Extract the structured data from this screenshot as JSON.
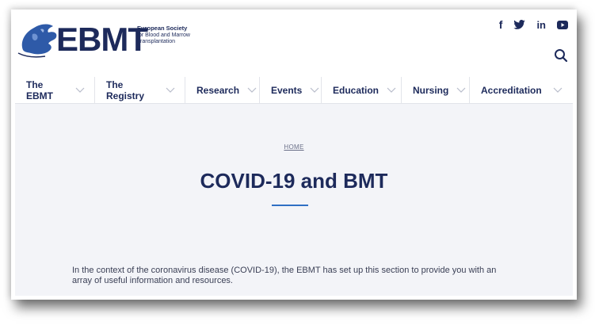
{
  "brand": {
    "logo_text": "EBMT",
    "tagline_line1": "European Society",
    "tagline_line2": "for Blood and Marrow",
    "tagline_line3": "Transplantation",
    "color_primary": "#1d2a5b",
    "color_accent": "#2f6fc4"
  },
  "social": {
    "icons": [
      "facebook-icon",
      "twitter-icon",
      "linkedin-icon",
      "youtube-icon"
    ],
    "facebook": "f",
    "linkedin": "in"
  },
  "nav": {
    "items": [
      {
        "label": "The EBMT"
      },
      {
        "label": "The Registry"
      },
      {
        "label": "Research"
      },
      {
        "label": "Events"
      },
      {
        "label": "Education"
      },
      {
        "label": "Nursing"
      },
      {
        "label": "Accreditation"
      }
    ]
  },
  "page": {
    "breadcrumb": "HOME",
    "title": "COVID-19 and BMT",
    "intro": "In the context of the coronavirus disease (COVID-19), the EBMT has set up this section to provide you with an array of useful information and resources."
  }
}
